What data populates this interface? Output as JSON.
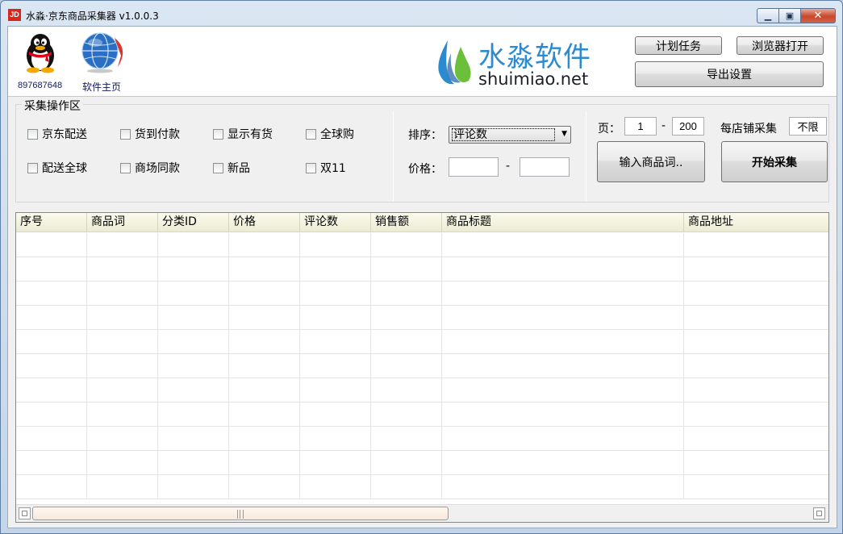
{
  "window": {
    "title": "水淼·京东商品采集器 v1.0.0.3",
    "app_icon_text": "JD"
  },
  "header": {
    "qq_number": "897687648",
    "home_link": "软件主页",
    "logo_cn": "水淼软件",
    "logo_en": "shuimiao.net",
    "plan_task": "计划任务",
    "browser_open": "浏览器打开",
    "export_settings": "导出设置"
  },
  "panel": {
    "title": "采集操作区",
    "checkboxes_row1": [
      "京东配送",
      "货到付款",
      "显示有货",
      "全球购"
    ],
    "checkboxes_row2": [
      "配送全球",
      "商场同款",
      "新品",
      "双11"
    ],
    "sort_label": "排序：",
    "sort_value": "评论数",
    "price_label": "价格：",
    "price_min": "",
    "price_max": "",
    "range_dash": "-",
    "page_label": "页：",
    "page_from": "1",
    "page_to": "200",
    "per_shop_label": "每店铺采集",
    "per_shop_value": "不限",
    "keyword_button": "输入商品词..",
    "start_button": "开始采集"
  },
  "table": {
    "columns": [
      "序号",
      "商品词",
      "分类ID",
      "价格",
      "评论数",
      "销售额",
      "商品标题",
      "商品地址"
    ],
    "rows": []
  },
  "colors": {
    "logo_blue": "#2c8ad0",
    "close_red": "#c7482b"
  }
}
